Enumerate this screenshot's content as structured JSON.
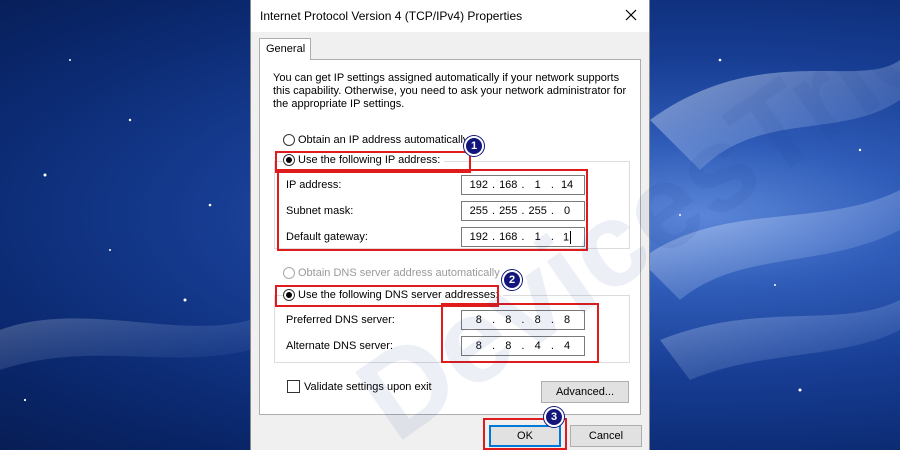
{
  "dialog": {
    "title": "Internet Protocol Version 4 (TCP/IPv4) Properties",
    "tab_label": "General",
    "intro_text": "You can get IP settings assigned automatically if your network supports this capability. Otherwise, you need to ask your network administrator for the appropriate IP settings."
  },
  "ip_section": {
    "auto_option": "Obtain an IP address automatically",
    "manual_option": "Use the following IP address:",
    "selected": "manual",
    "fields": [
      {
        "label": "IP address:",
        "octets": [
          "192",
          "168",
          "1",
          "14"
        ]
      },
      {
        "label": "Subnet mask:",
        "octets": [
          "255",
          "255",
          "255",
          "0"
        ]
      },
      {
        "label": "Default gateway:",
        "octets": [
          "192",
          "168",
          "1",
          "1"
        ]
      }
    ]
  },
  "dns_section": {
    "auto_option": "Obtain DNS server address automatically",
    "manual_option": "Use the following DNS server addresses:",
    "selected": "manual",
    "fields": [
      {
        "label": "Preferred DNS server:",
        "octets": [
          "8",
          "8",
          "8",
          "8"
        ]
      },
      {
        "label": "Alternate DNS server:",
        "octets": [
          "8",
          "8",
          "4",
          "4"
        ]
      }
    ]
  },
  "validate_checkbox": {
    "label": "Validate settings upon exit",
    "checked": false
  },
  "buttons": {
    "advanced": "Advanced...",
    "ok": "OK",
    "cancel": "Cancel"
  },
  "step_badges": [
    "1",
    "2",
    "3"
  ],
  "watermark": "DevicesTricks",
  "colors": {
    "highlight": "#e01b1b",
    "badge": "#12157c",
    "window": "#f0f0f0",
    "desktop": "#173d93"
  },
  "icons": {
    "close": "close-icon",
    "caret": "text-caret"
  }
}
